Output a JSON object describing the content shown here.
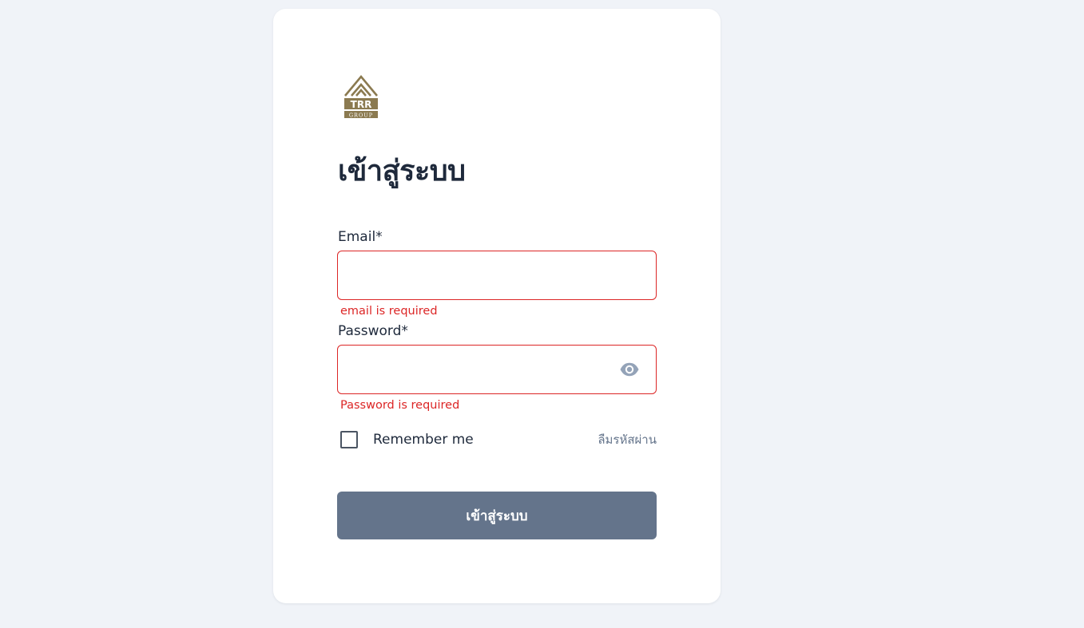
{
  "logo": {
    "text": "TRR",
    "subtext": "GROUP",
    "color": "#8b7a50"
  },
  "login": {
    "title": "เข้าสู่ระบบ",
    "email": {
      "label": "Email*",
      "value": "",
      "placeholder": "",
      "error": "email is required"
    },
    "password": {
      "label": "Password*",
      "value": "",
      "placeholder": "",
      "error": "Password is required",
      "toggle_icon": "eye-icon"
    },
    "remember_label": "Remember me",
    "remember_checked": false,
    "forgot_label": "ลืมรหัสผ่าน",
    "submit_label": "เข้าสู่ระบบ"
  },
  "colors": {
    "background": "#f0f3f8",
    "error": "#dc2626",
    "button": "#64748b",
    "text": "#1e293b"
  }
}
